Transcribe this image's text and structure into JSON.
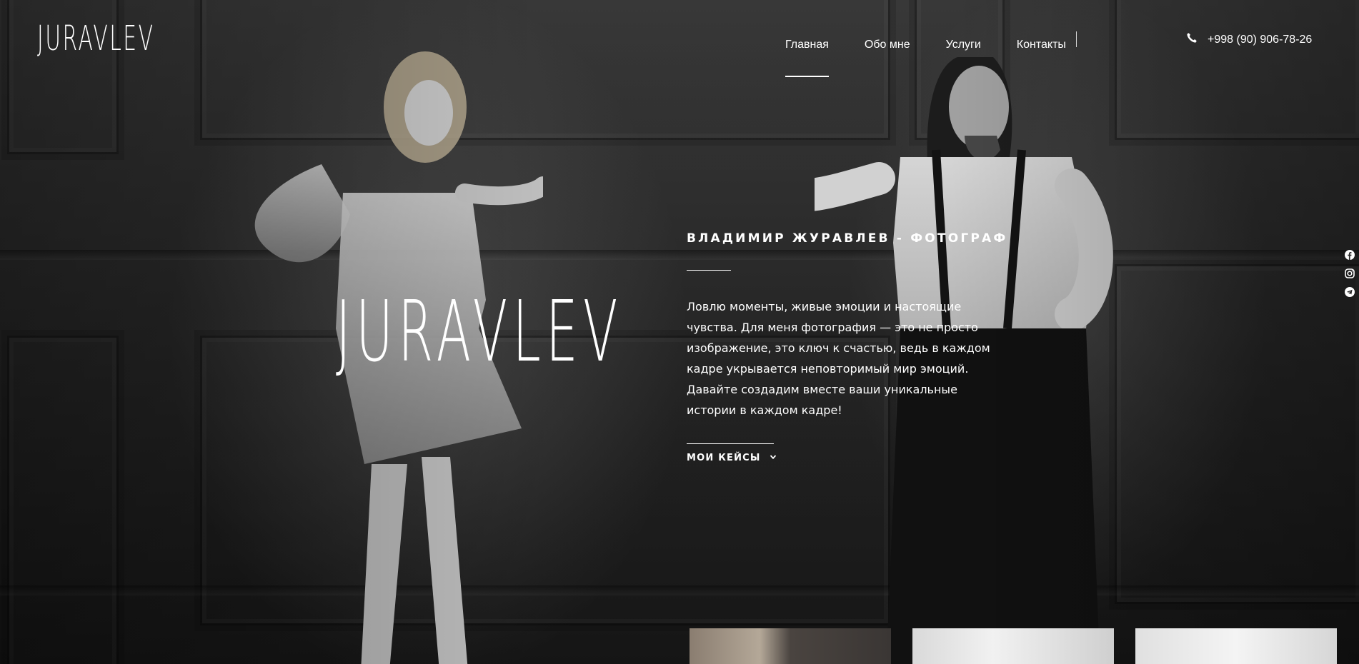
{
  "header": {
    "logo": "JURAVLEV",
    "nav": [
      {
        "label": "Главная",
        "active": true
      },
      {
        "label": "Обо мне",
        "active": false
      },
      {
        "label": "Услуги",
        "active": false
      },
      {
        "label": "Контакты",
        "active": false
      }
    ],
    "phone": "+998 (90) 906-78-26",
    "phone_icon": "phone-icon"
  },
  "social": [
    "facebook-icon",
    "instagram-icon",
    "telegram-icon"
  ],
  "hero": {
    "logo": "JURAVLEV",
    "subtitle": "ВЛАДИМИР ЖУРАВЛЕВ - ФОТОГРАФ",
    "text": "Ловлю моменты, живые эмоции и настоящие чувства. Для меня фотография — это не просто изображение, это ключ к счастью, ведь в каждом кадре укрывается неповторимый мир эмоций. Давайте создадим вместе ваши уникальные истории в каждом кадре!",
    "cases_label": "МОИ КЕЙСЫ",
    "cases_icon": "chevron-down-icon"
  },
  "colors": {
    "text": "#ffffff",
    "background": "#2a2a2a"
  }
}
